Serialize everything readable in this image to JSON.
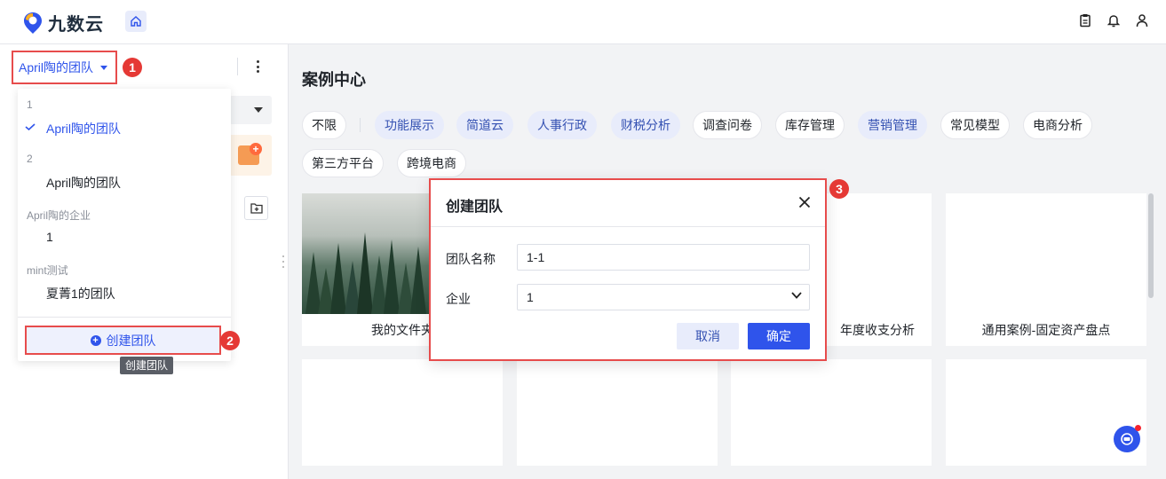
{
  "app": {
    "name": "九数云"
  },
  "sidebar": {
    "current_team": "April陶的团队",
    "dropdown": {
      "groups": [
        {
          "group": "1",
          "item": "April陶的团队",
          "selected": true
        },
        {
          "group": "2",
          "item": "April陶的团队",
          "selected": false
        },
        {
          "group": "April陶的企业",
          "item": "1",
          "selected": false
        },
        {
          "group": "mint测试",
          "item": "夏菁1的团队",
          "selected": false
        }
      ],
      "create_label": "创建团队",
      "tooltip": "创建团队"
    }
  },
  "badges": [
    "1",
    "2",
    "3"
  ],
  "main": {
    "title": "案例中心",
    "tags": [
      {
        "label": "不限",
        "active": false
      },
      {
        "label": "功能展示",
        "active": true
      },
      {
        "label": "简道云",
        "active": true
      },
      {
        "label": "人事行政",
        "active": true
      },
      {
        "label": "财税分析",
        "active": true
      },
      {
        "label": "调查问卷",
        "active": false
      },
      {
        "label": "库存管理",
        "active": false
      },
      {
        "label": "营销管理",
        "active": true
      },
      {
        "label": "常见模型",
        "active": false
      },
      {
        "label": "电商分析",
        "active": false
      },
      {
        "label": "第三方平台",
        "active": false
      },
      {
        "label": "跨境电商",
        "active": false
      }
    ],
    "cards": [
      {
        "label": "我的文件夹"
      },
      {
        "label": ""
      },
      {
        "label": "年度收支分析"
      },
      {
        "label": "通用案例-固定资产盘点"
      }
    ]
  },
  "modal": {
    "title": "创建团队",
    "name_label": "团队名称",
    "name_value": "1-1",
    "company_label": "企业",
    "company_value": "1",
    "cancel_label": "取消",
    "ok_label": "确定"
  },
  "colors": {
    "accent": "#2f54eb",
    "highlight_border": "#e74c4c",
    "badge": "#e53935"
  }
}
